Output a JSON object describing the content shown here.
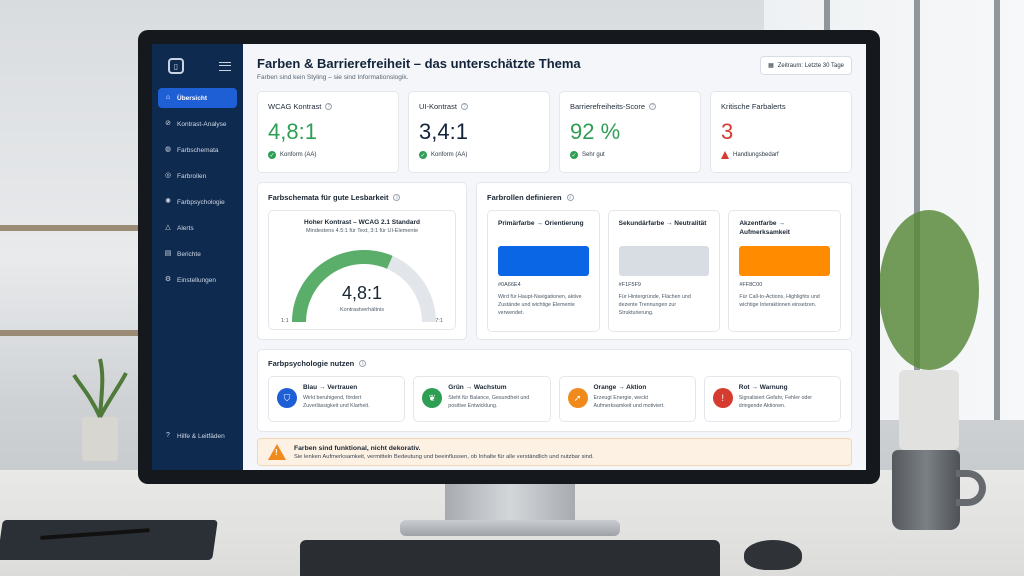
{
  "sidebar": {
    "logo": "book-icon",
    "items": [
      {
        "label": "Übersicht",
        "icon": "home-icon",
        "active": true
      },
      {
        "label": "Kontrast-Analyse",
        "icon": "contrast-icon",
        "active": false
      },
      {
        "label": "Farbschemata",
        "icon": "palette-icon",
        "active": false
      },
      {
        "label": "Farbrollen",
        "icon": "roles-icon",
        "active": false
      },
      {
        "label": "Farbpsychologie",
        "icon": "brain-icon",
        "active": false
      },
      {
        "label": "Alerts",
        "icon": "alert-icon",
        "active": false
      },
      {
        "label": "Berichte",
        "icon": "report-icon",
        "active": false
      },
      {
        "label": "Einstellungen",
        "icon": "gear-icon",
        "active": false
      }
    ],
    "help": "Hilfe & Leitfäden"
  },
  "header": {
    "title": "Farben & Barrierefreiheit – das unterschätzte Thema",
    "subtitle": "Farben sind kein Styling – sie sind Informationslogik.",
    "period": "Zeitraum: Letzte 30 Tage"
  },
  "kpis": [
    {
      "label": "WCAG Kontrast",
      "value": "4,8:1",
      "status": "Konform (AA)",
      "color": "#2f9e55"
    },
    {
      "label": "UI-Kontrast",
      "value": "3,4:1",
      "status": "Konform (AA)",
      "color": "#13243a"
    },
    {
      "label": "Barrierefreiheits-Score",
      "value": "92 %",
      "status": "Sehr gut",
      "color": "#2f9e55"
    },
    {
      "label": "Kritische Farbalerts",
      "value": "3",
      "status": "Handlungsbedarf",
      "color": "#d63b2f"
    }
  ],
  "schemes": {
    "title": "Farbschemata für gute Lesbarkeit",
    "card_title": "Hoher Kontrast – WCAG 2.1 Standard",
    "card_sub": "Mindestens 4.5:1 für Text, 3:1 für UI-Elemente",
    "gauge_value": "4,8:1",
    "gauge_caption": "Kontrastverhältnis",
    "gauge_min": "1:1",
    "gauge_max": "7:1",
    "gauge_fraction": 0.63
  },
  "roles": {
    "title": "Farbrollen definieren",
    "items": [
      {
        "name": "Primärfarbe → Orientierung",
        "hex": "#0A66E4",
        "desc": "Wird für Haupt-Navigationen, aktive Zustände und wichtige Elemente verwendet."
      },
      {
        "name": "Sekundärfarbe → Neutralität",
        "hex": "#F1F5F9",
        "desc": "Für Hintergründe, Flächen und dezente Trennungen zur Strukturierung."
      },
      {
        "name": "Akzentfarbe → Aufmerksamkeit",
        "hex": "#FF8C00",
        "desc": "Für Call-to-Actions, Highlights und wichtige Interaktionen einsetzen."
      }
    ]
  },
  "psych": {
    "title": "Farbpsychologie nutzen",
    "items": [
      {
        "title": "Blau → Vertrauen",
        "desc": "Wirkt beruhigend, fördert Zuverlässigkeit und Klarheit.",
        "color": "#1f5fd6",
        "icon": "shield-icon"
      },
      {
        "title": "Grün → Wachstum",
        "desc": "Steht für Balance, Gesundheit und positive Entwicklung.",
        "color": "#2f9e55",
        "icon": "leaf-icon"
      },
      {
        "title": "Orange → Aktion",
        "desc": "Erzeugt Energie, weckt Aufmerksamkeit und motiviert.",
        "color": "#f08a1c",
        "icon": "cursor-icon"
      },
      {
        "title": "Rot → Warnung",
        "desc": "Signalisiert Gefahr, Fehler oder dringende Aktionen.",
        "color": "#d63b2f",
        "icon": "warning-icon"
      }
    ]
  },
  "banner": {
    "title": "Farben sind funktional, nicht dekorativ.",
    "text": "Sie lenken Aufmerksamkeit, vermitteln Bedeutung und beeinflussen, ob Inhalte für alle verständlich und nutzbar sind."
  }
}
